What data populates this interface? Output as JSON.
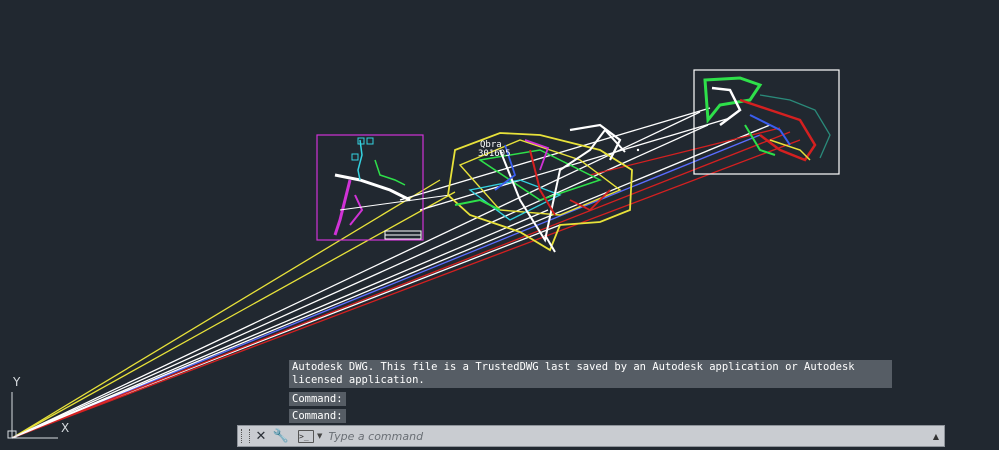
{
  "command_history": {
    "message": "Autodesk DWG.  This file is a TrustedDWG last saved by an Autodesk application or Autodesk licensed application.",
    "prompts": [
      "Command:",
      "Command:"
    ]
  },
  "command_line": {
    "placeholder": "Type a command",
    "close_icon": "close-icon",
    "customize_icon": "wrench-icon",
    "recent_commands_icon": "prompt-icon",
    "expand_icon": "up-arrow-icon"
  },
  "ucs": {
    "x_label": "X",
    "y_label": "Y"
  },
  "drawing": {
    "text_label_1": "Qbra",
    "text_label_2": "301605",
    "colors": {
      "background": "#212830",
      "yellow": "#e8e23a",
      "white": "#ffffff",
      "red": "#d42020",
      "green": "#2ee04a",
      "magenta": "#d032d6",
      "blue": "#3a5ef0",
      "cyan": "#34d2e0"
    }
  }
}
